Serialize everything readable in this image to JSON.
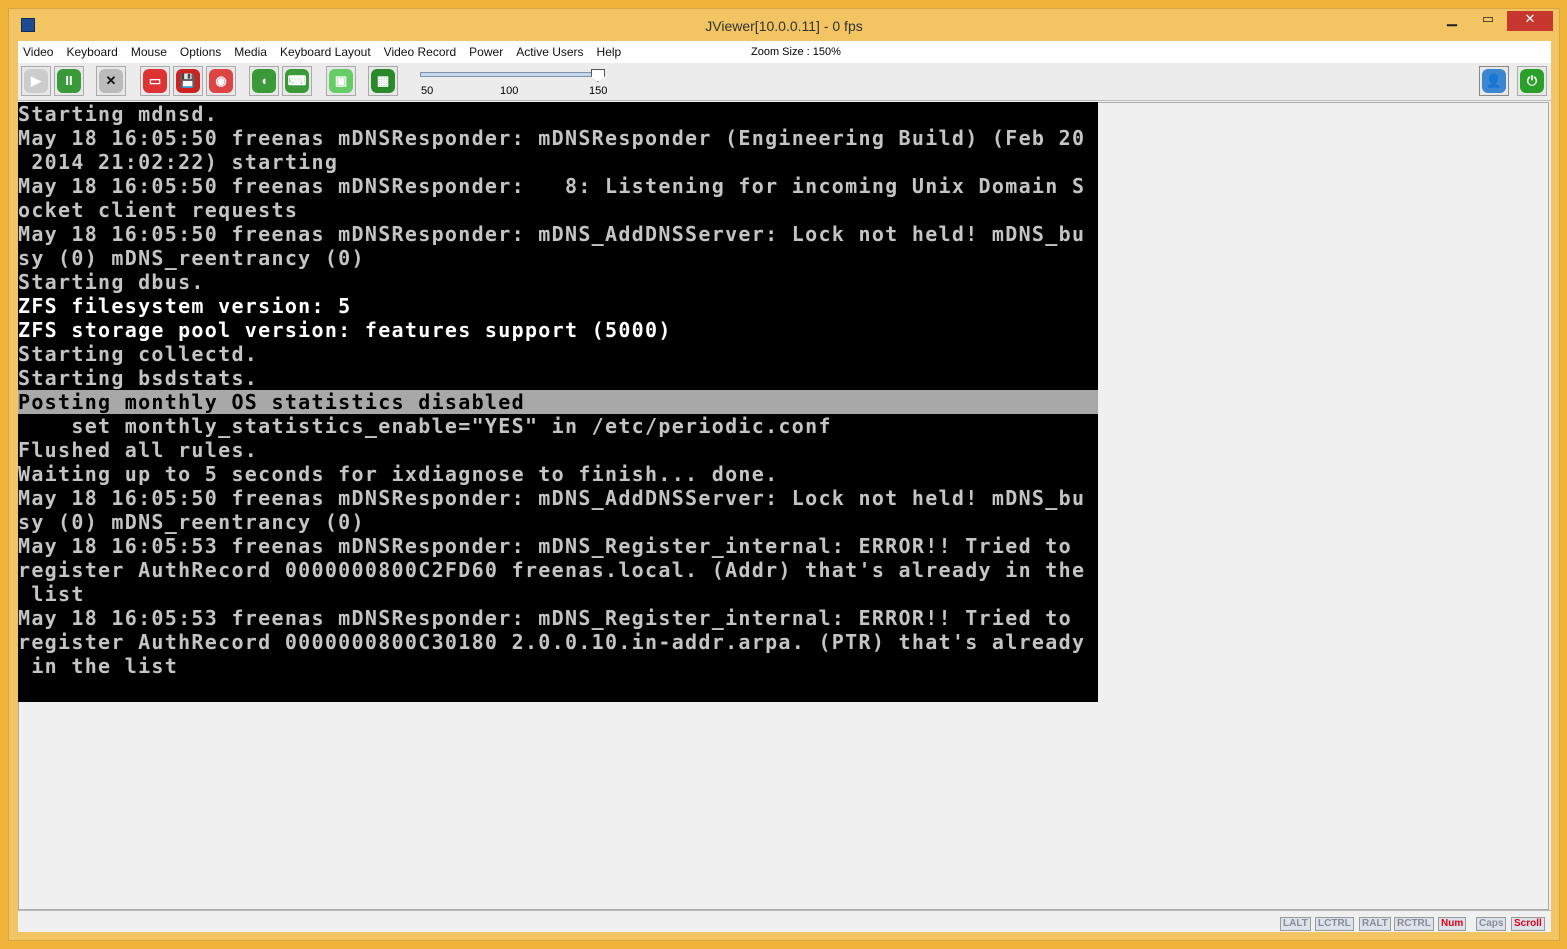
{
  "window": {
    "title": "JViewer[10.0.0.11] - 0 fps",
    "minimize": "▁",
    "maximize": "▭",
    "close": "✕"
  },
  "menu": [
    "Video",
    "Keyboard",
    "Mouse",
    "Options",
    "Media",
    "Keyboard Layout",
    "Video Record",
    "Power",
    "Active Users",
    "Help"
  ],
  "zoom_size": "Zoom Size : 150%",
  "slider": {
    "ticks": [
      "50",
      "100",
      "150"
    ],
    "value": 150,
    "min": 50,
    "max": 150
  },
  "console": [
    {
      "t": "Starting mdnsd.",
      "s": ""
    },
    {
      "t": "May 18 16:05:50 freenas mDNSResponder: mDNSResponder (Engineering Build) (Feb 20",
      "s": ""
    },
    {
      "t": " 2014 21:02:22) starting",
      "s": ""
    },
    {
      "t": "May 18 16:05:50 freenas mDNSResponder:   8: Listening for incoming Unix Domain S",
      "s": ""
    },
    {
      "t": "ocket client requests",
      "s": ""
    },
    {
      "t": "May 18 16:05:50 freenas mDNSResponder: mDNS_AddDNSServer: Lock not held! mDNS_bu",
      "s": ""
    },
    {
      "t": "sy (0) mDNS_reentrancy (0)",
      "s": ""
    },
    {
      "t": "Starting dbus.",
      "s": ""
    },
    {
      "t": "ZFS filesystem version: 5",
      "s": "w"
    },
    {
      "t": "ZFS storage pool version: features support (5000)",
      "s": "w"
    },
    {
      "t": "Starting collectd.",
      "s": ""
    },
    {
      "t": "Starting bsdstats.",
      "s": ""
    },
    {
      "t": "Posting monthly OS statistics disabled",
      "s": "hl"
    },
    {
      "t": "    set monthly_statistics_enable=\"YES\" in /etc/periodic.conf",
      "s": ""
    },
    {
      "t": "Flushed all rules.",
      "s": ""
    },
    {
      "t": "Waiting up to 5 seconds for ixdiagnose to finish... done.",
      "s": ""
    },
    {
      "t": "May 18 16:05:50 freenas mDNSResponder: mDNS_AddDNSServer: Lock not held! mDNS_bu",
      "s": ""
    },
    {
      "t": "sy (0) mDNS_reentrancy (0)",
      "s": ""
    },
    {
      "t": "May 18 16:05:53 freenas mDNSResponder: mDNS_Register_internal: ERROR!! Tried to",
      "s": ""
    },
    {
      "t": "register AuthRecord 0000000800C2FD60 freenas.local. (Addr) that's already in the",
      "s": ""
    },
    {
      "t": " list",
      "s": ""
    },
    {
      "t": "May 18 16:05:53 freenas mDNSResponder: mDNS_Register_internal: ERROR!! Tried to",
      "s": ""
    },
    {
      "t": "register AuthRecord 0000000800C30180 2.0.0.10.in-addr.arpa. (PTR) that's already",
      "s": ""
    },
    {
      "t": " in the list",
      "s": ""
    }
  ],
  "status_keys": [
    {
      "k": "LALT",
      "on": false
    },
    {
      "k": "LCTRL",
      "on": false
    },
    {
      "k": "RALT",
      "on": false
    },
    {
      "k": "RCTRL",
      "on": false
    },
    {
      "k": "Num",
      "on": true
    },
    {
      "k": "Caps",
      "on": false
    },
    {
      "k": "Scroll",
      "on": true
    }
  ]
}
